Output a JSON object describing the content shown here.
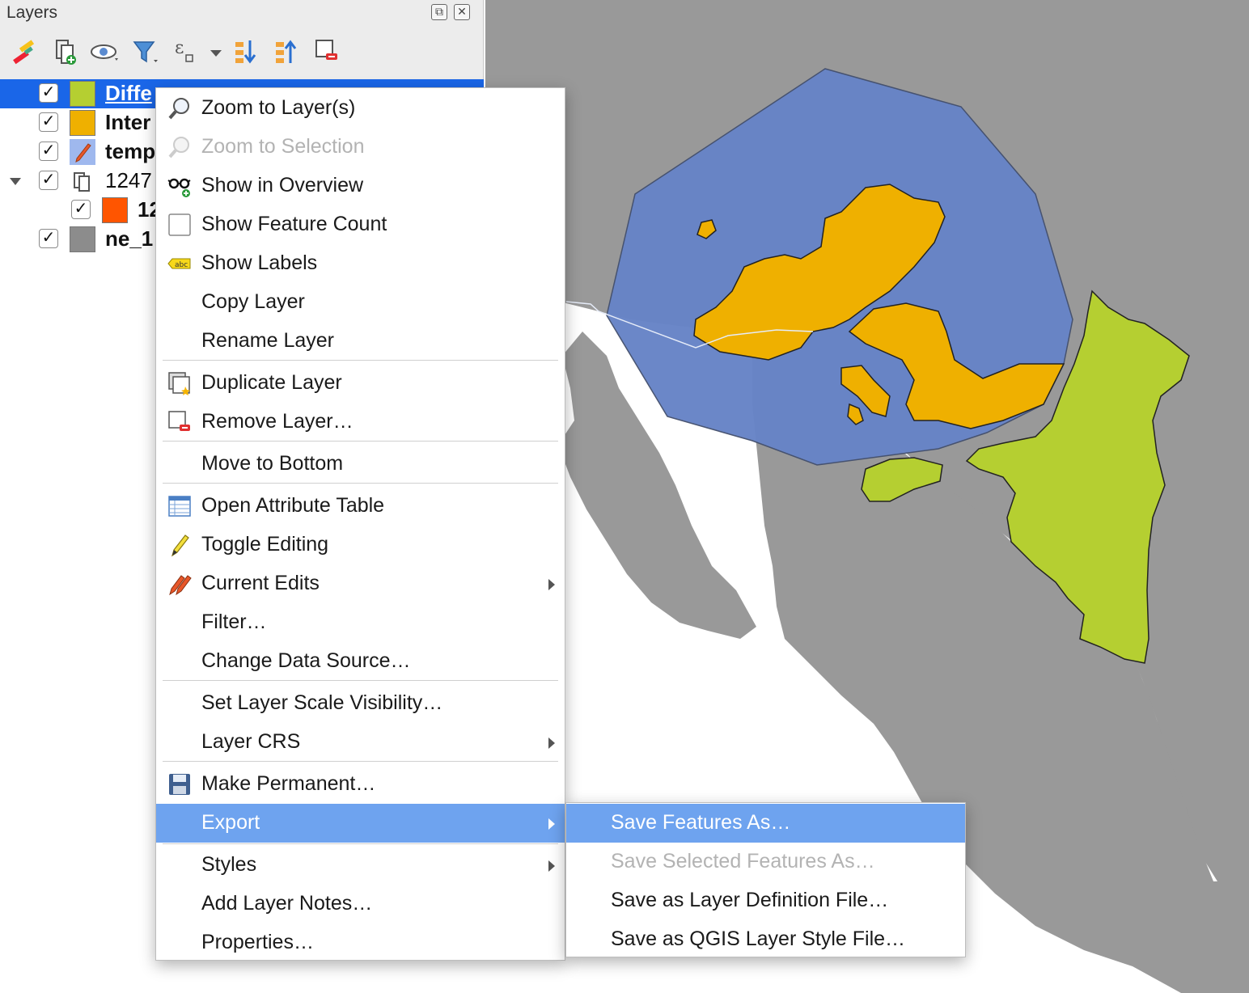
{
  "panel": {
    "title": "Layers"
  },
  "toolbar": {
    "icons": [
      "style-brush-icon",
      "add-group-icon",
      "visibility-eye-icon",
      "filter-icon",
      "expression-filter-icon",
      "expand-all-icon",
      "collapse-all-icon",
      "remove-layer-icon"
    ]
  },
  "layers": [
    {
      "name": "Diffe",
      "color": "#b5cf31",
      "checked": "✓",
      "selected": true
    },
    {
      "name": "Inter",
      "color": "#efb000",
      "checked": "✓"
    },
    {
      "name": "temp",
      "color": "#9fb8ee",
      "checked": "✓"
    },
    {
      "name": "1247",
      "checked": "✓"
    },
    {
      "name": "12",
      "color": "#ff5500",
      "checked": "✓"
    },
    {
      "name": "ne_1",
      "color": "#8c8c8c",
      "checked": "✓"
    }
  ],
  "context_menu": {
    "items": [
      {
        "label": "Zoom to Layer(s)"
      },
      {
        "label": "Zoom to Selection",
        "disabled": true
      },
      {
        "label": "Show in Overview"
      },
      {
        "label": "Show Feature Count"
      },
      {
        "label": "Show Labels"
      },
      {
        "label": "Copy Layer"
      },
      {
        "label": "Rename Layer"
      },
      {
        "label": "Duplicate Layer"
      },
      {
        "label": "Remove Layer…"
      },
      {
        "label": "Move to Bottom"
      },
      {
        "label": "Open Attribute Table"
      },
      {
        "label": "Toggle Editing"
      },
      {
        "label": "Current Edits"
      },
      {
        "label": "Filter…"
      },
      {
        "label": "Change Data Source…"
      },
      {
        "label": "Set Layer Scale Visibility…"
      },
      {
        "label": "Layer CRS"
      },
      {
        "label": "Make Permanent…"
      },
      {
        "label": "Export"
      },
      {
        "label": "Styles"
      },
      {
        "label": "Add Layer Notes…"
      },
      {
        "label": "Properties…"
      }
    ]
  },
  "export_menu": {
    "items": [
      {
        "label": "Save Features As…"
      },
      {
        "label": "Save Selected Features As…",
        "disabled": true
      },
      {
        "label": "Save as Layer Definition File…"
      },
      {
        "label": "Save as QGIS Layer Style File…"
      }
    ]
  },
  "colors": {
    "selection": "#1a66e8",
    "menu_highlight": "#6ea3ef",
    "difference_layer": "#b5cf31",
    "intersection_layer": "#efb000",
    "hull_layer": "#6784c7",
    "land": "#999999"
  }
}
